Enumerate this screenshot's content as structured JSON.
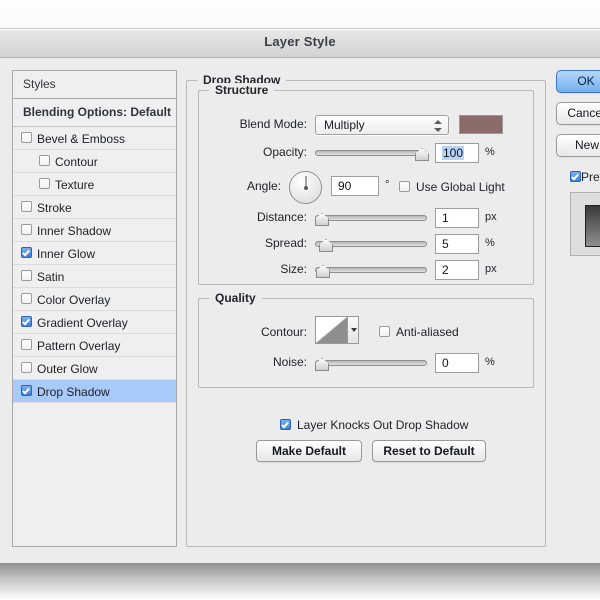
{
  "window": {
    "title": "Layer Style"
  },
  "styles_panel": {
    "header": "Styles",
    "blending_options": "Blending Options: Default",
    "effects": [
      {
        "label": "Bevel & Emboss",
        "checked": false,
        "sub": false,
        "selected": false
      },
      {
        "label": "Contour",
        "checked": false,
        "sub": true,
        "selected": false
      },
      {
        "label": "Texture",
        "checked": false,
        "sub": true,
        "selected": false
      },
      {
        "label": "Stroke",
        "checked": false,
        "sub": false,
        "selected": false
      },
      {
        "label": "Inner Shadow",
        "checked": false,
        "sub": false,
        "selected": false
      },
      {
        "label": "Inner Glow",
        "checked": true,
        "sub": false,
        "selected": false
      },
      {
        "label": "Satin",
        "checked": false,
        "sub": false,
        "selected": false
      },
      {
        "label": "Color Overlay",
        "checked": false,
        "sub": false,
        "selected": false
      },
      {
        "label": "Gradient Overlay",
        "checked": true,
        "sub": false,
        "selected": false
      },
      {
        "label": "Pattern Overlay",
        "checked": false,
        "sub": false,
        "selected": false
      },
      {
        "label": "Outer Glow",
        "checked": false,
        "sub": false,
        "selected": false
      },
      {
        "label": "Drop Shadow",
        "checked": true,
        "sub": false,
        "selected": true
      }
    ]
  },
  "drop_shadow": {
    "group_title": "Drop Shadow",
    "structure": {
      "legend": "Structure",
      "blend_mode_label": "Blend Mode:",
      "blend_mode_value": "Multiply",
      "shadow_color": "#8b6a6a",
      "opacity_label": "Opacity:",
      "opacity_value": "100",
      "opacity_unit": "%",
      "angle_label": "Angle:",
      "angle_value": "90",
      "angle_unit": "°",
      "use_global_light_label": "Use Global Light",
      "use_global_light_checked": false,
      "distance_label": "Distance:",
      "distance_value": "1",
      "distance_unit": "px",
      "spread_label": "Spread:",
      "spread_value": "5",
      "spread_unit": "%",
      "size_label": "Size:",
      "size_value": "2",
      "size_unit": "px"
    },
    "quality": {
      "legend": "Quality",
      "contour_label": "Contour:",
      "anti_aliased_label": "Anti-aliased",
      "anti_aliased_checked": false,
      "noise_label": "Noise:",
      "noise_value": "0",
      "noise_unit": "%"
    },
    "knockout_label": "Layer Knocks Out Drop Shadow",
    "knockout_checked": true,
    "make_default_label": "Make Default",
    "reset_default_label": "Reset to Default"
  },
  "action_buttons": {
    "ok": "OK",
    "cancel": "Cancel",
    "new_style": "New Style...",
    "preview_label": "Preview",
    "preview_checked": true
  }
}
